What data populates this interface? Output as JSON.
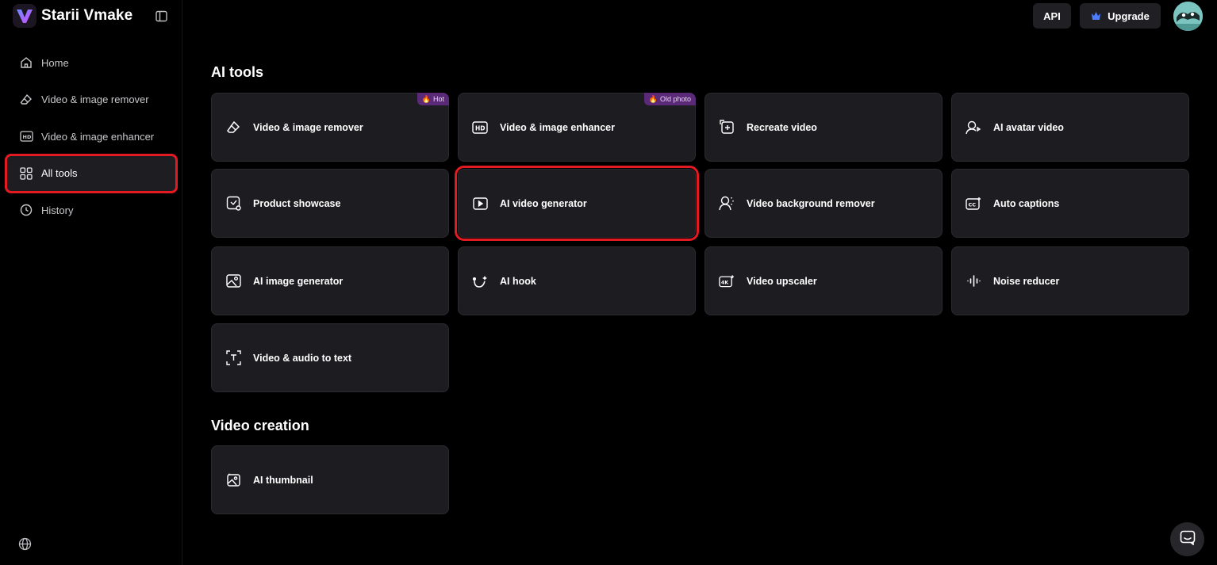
{
  "app": {
    "name": "Starii Vmake"
  },
  "sidebar": {
    "items": [
      {
        "label": "Home",
        "icon": "home-icon"
      },
      {
        "label": "Video & image remover",
        "icon": "eraser-icon"
      },
      {
        "label": "Video & image enhancer",
        "icon": "hd-icon"
      },
      {
        "label": "All tools",
        "icon": "grid-icon",
        "active": true
      },
      {
        "label": "History",
        "icon": "clock-icon"
      }
    ]
  },
  "header": {
    "api_label": "API",
    "upgrade_label": "Upgrade"
  },
  "sections": {
    "ai_tools_title": "AI tools",
    "video_creation_title": "Video creation"
  },
  "tools": {
    "remover": {
      "label": "Video & image remover",
      "badge": "Hot"
    },
    "enhancer": {
      "label": "Video & image enhancer",
      "badge": "Old photo"
    },
    "recreate": {
      "label": "Recreate video"
    },
    "avatar": {
      "label": "AI avatar video"
    },
    "product": {
      "label": "Product showcase"
    },
    "generator": {
      "label": "AI video generator"
    },
    "bg_remover": {
      "label": "Video background remover"
    },
    "captions": {
      "label": "Auto captions"
    },
    "image_gen": {
      "label": "AI image generator"
    },
    "hook": {
      "label": "AI hook"
    },
    "upscaler": {
      "label": "Video upscaler"
    },
    "noise": {
      "label": "Noise reducer"
    },
    "to_text": {
      "label": "Video & audio to text"
    },
    "thumbnail": {
      "label": "AI thumbnail"
    }
  },
  "colors": {
    "highlight": "#e21b23",
    "badge_bg": "#5a2a78",
    "card_bg": "#1d1d21",
    "logo_gradient_start": "#5b8cff",
    "logo_gradient_end": "#c04bff"
  }
}
